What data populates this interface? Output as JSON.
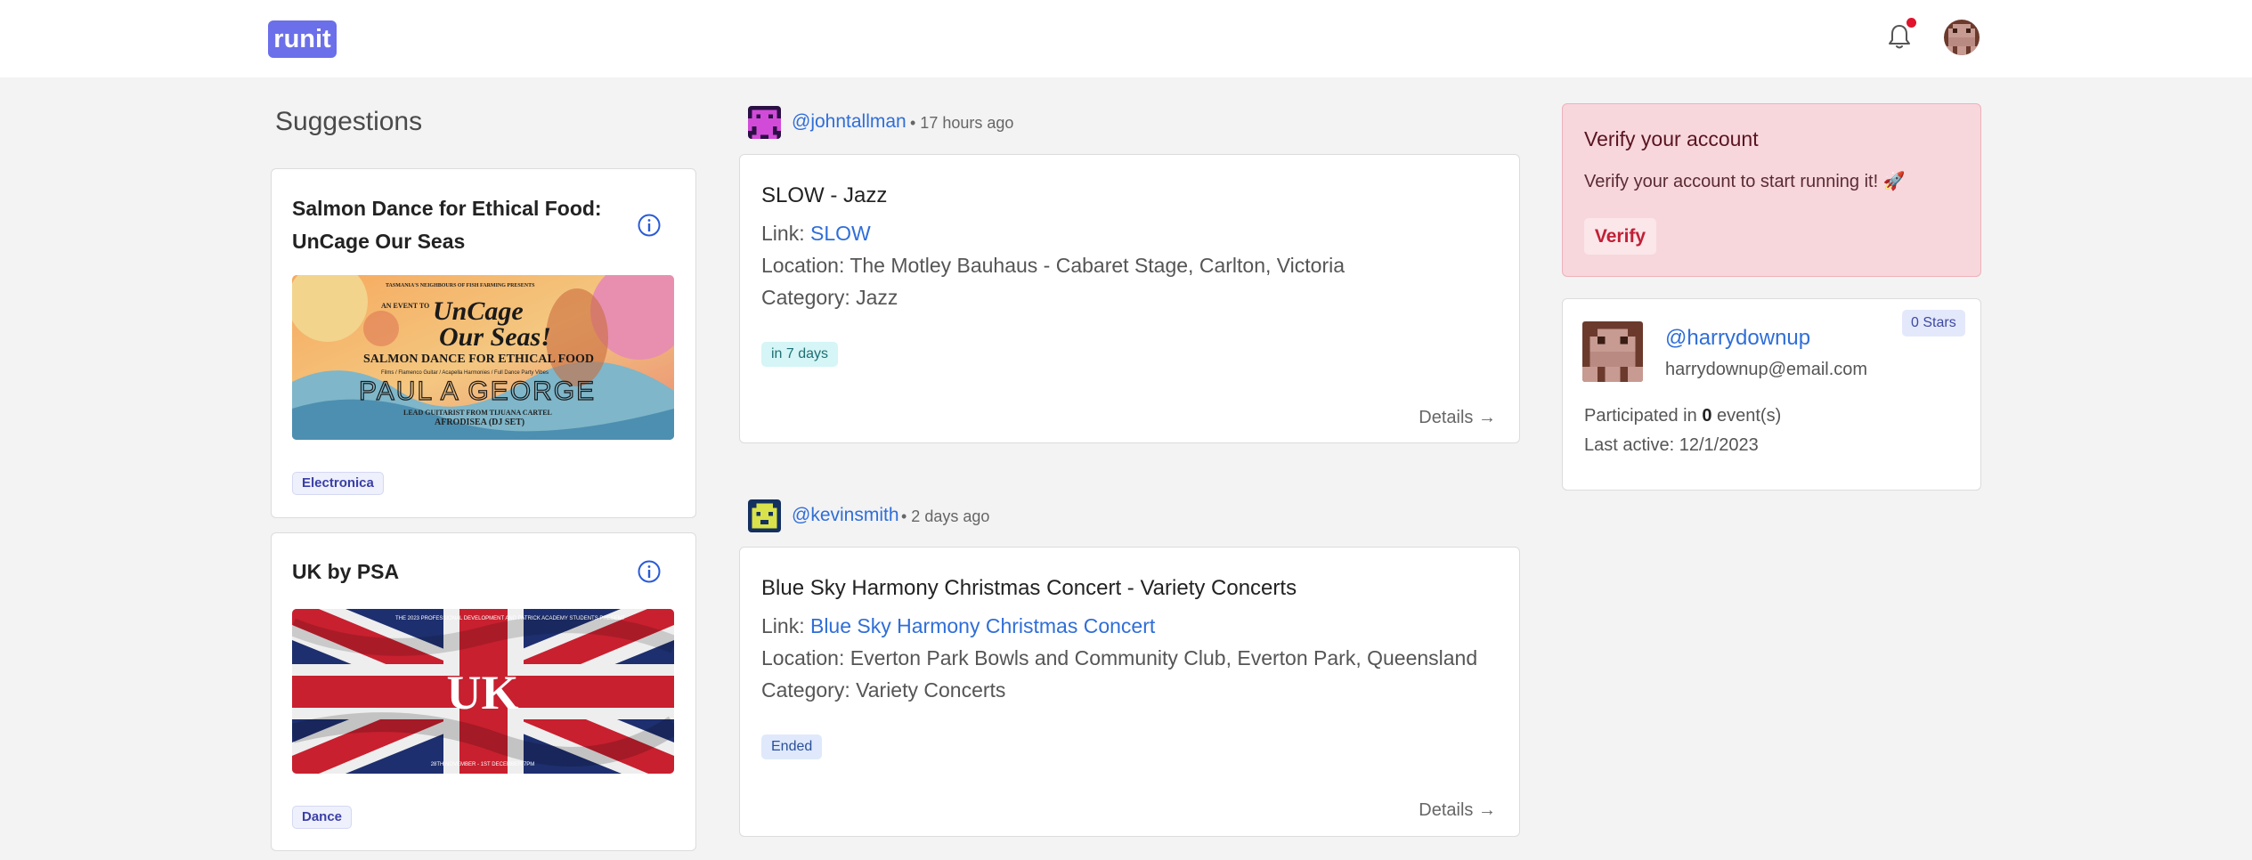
{
  "header": {
    "logo_text": "runit",
    "notification_dot_color": "#e0132d"
  },
  "suggestions": {
    "title": "Suggestions",
    "items": [
      {
        "title": "Salmon Dance for Ethical Food: UnCage Our Seas",
        "tag": "Electronica",
        "poster": {
          "small_top": "TASMANIA'S NEIGHBOURS OF FISH FARMING PRESENTS",
          "event_to": "AN EVENT TO",
          "headline1": "UnCage",
          "headline2": "Our Seas!",
          "subhead": "SALMON DANCE FOR ETHICAL FOOD",
          "fine_print": "Films / Flamenco Guitar / Acapella Harmonies / Full Dance Party Vibes",
          "artist": "PAUL A GEORGE",
          "lead": "LEAD GUITARIST FROM TIJUANA CARTEL",
          "dj": "AFRODISEA (DJ SET)"
        }
      },
      {
        "title": "UK by PSA",
        "tag": "Dance",
        "poster": {
          "small_top": "THE 2023 PROFESSIONAL DEVELOPMENT AND PATRICK ACADEMY STUDENTS PRESENT",
          "headline": "UK",
          "dates": "28TH NOVEMBER - 1ST DECEMBER 7PM"
        }
      }
    ]
  },
  "feed": [
    {
      "username": "@johntallman",
      "time": "• 17 hours ago",
      "title": "SLOW - Jazz",
      "link_label": "Link:",
      "link_text": "SLOW",
      "location_label": "Location:",
      "location": "The Motley Bauhaus - Cabaret Stage, Carlton, Victoria",
      "category_label": "Category:",
      "category": "Jazz",
      "badge": "in 7 days",
      "details": "Details →"
    },
    {
      "username": "@kevinsmith",
      "time": "• 2 days ago",
      "title": "Blue Sky Harmony Christmas Concert - Variety Concerts",
      "link_label": "Link:",
      "link_text": "Blue Sky Harmony Christmas Concert",
      "location_label": "Location:",
      "location": "Everton Park Bowls and Community Club, Everton Park, Queensland",
      "category_label": "Category:",
      "category": "Variety Concerts",
      "badge": "Ended",
      "details": "Details →"
    }
  ],
  "verify": {
    "title": "Verify your account",
    "text": "Verify your account to start running it! 🚀",
    "button": "Verify"
  },
  "profile": {
    "username": "@harrydownup",
    "email": "harrydownup@email.com",
    "stars": "0 Stars",
    "participated_prefix": "Participated in",
    "participated_count": "0",
    "participated_suffix": "event(s)",
    "last_active": "Last active: 12/1/2023"
  }
}
